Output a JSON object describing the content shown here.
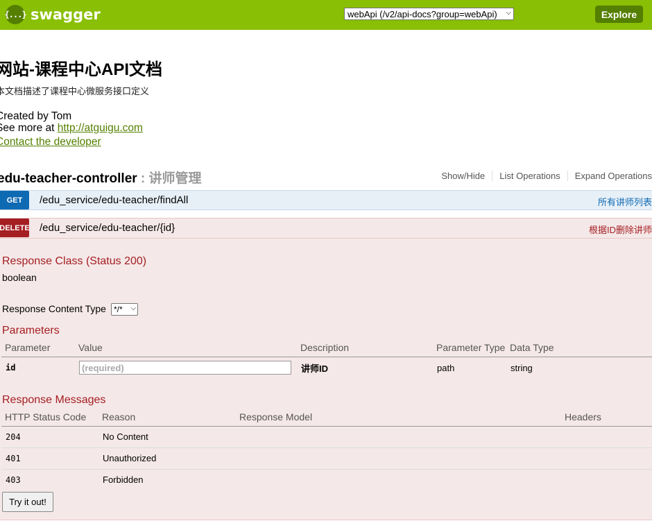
{
  "header": {
    "logo_icon": "{...}",
    "logo_text": "swagger",
    "api_select_value": "webApi (/v2/api-docs?group=webApi)",
    "explore_label": "Explore",
    "accent_color": "#89bf04"
  },
  "info": {
    "title": "网站-课程中心API文档",
    "description": "本文档描述了课程中心微服务接口定义",
    "created_by": "Created by Tom",
    "see_more_prefix": "See more at ",
    "see_more_link": "http://atguigu.com",
    "contact_link": "Contact the developer"
  },
  "controller": {
    "name": "edu-teacher-controller",
    "separator": " : ",
    "description": "讲师管理",
    "ops": [
      "Show/Hide",
      "List Operations",
      "Expand Operations"
    ]
  },
  "operations": [
    {
      "method": "GET",
      "path": "/edu_service/edu-teacher/findAll",
      "summary": "所有讲师列表",
      "color": "#0f6ab4"
    },
    {
      "method": "DELETE",
      "path": "/edu_service/edu-teacher/{id}",
      "summary": "根据ID删除讲师",
      "color": "#a41e22"
    }
  ],
  "detail": {
    "response_class_heading": "Response Class (Status 200)",
    "response_class_value": "boolean",
    "response_content_type_label": "Response Content Type",
    "response_content_type_value": "*/*",
    "parameters_heading": "Parameters",
    "param_headers": [
      "Parameter",
      "Value",
      "Description",
      "Parameter Type",
      "Data Type"
    ],
    "params": [
      {
        "name": "id",
        "placeholder": "(required)",
        "description": "讲师ID",
        "param_type": "path",
        "data_type": "string"
      }
    ],
    "response_messages_heading": "Response Messages",
    "resp_headers": [
      "HTTP Status Code",
      "Reason",
      "Response Model",
      "Headers"
    ],
    "responses": [
      {
        "code": "204",
        "reason": "No Content"
      },
      {
        "code": "401",
        "reason": "Unauthorized"
      },
      {
        "code": "403",
        "reason": "Forbidden"
      }
    ],
    "try_label": "Try it out!"
  }
}
